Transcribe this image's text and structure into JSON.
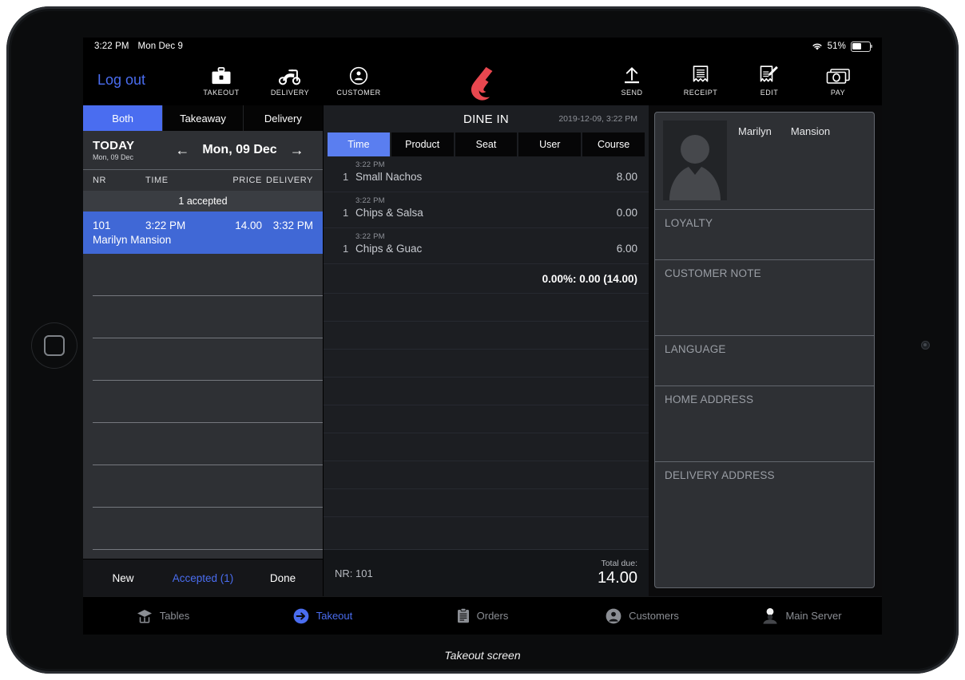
{
  "caption": "Takeout screen",
  "colors": {
    "accent_blue": "#4a6df0",
    "selected_row_blue": "#4068d6",
    "tab_active_blue": "#5a7ef0",
    "brand_red": "#e8474f",
    "panel_grey": "#2e3034",
    "mid_panel": "#1c1e22"
  },
  "status_bar": {
    "time": "3:22 PM",
    "date": "Mon Dec 9",
    "wifi_icon": "wifi-icon",
    "battery_percent": "51%",
    "battery_icon": "battery-icon"
  },
  "top_bar": {
    "logout_label": "Log out",
    "left_tools": [
      {
        "label": "TAKEOUT",
        "icon": "briefcase-icon"
      },
      {
        "label": "DELIVERY",
        "icon": "scooter-icon"
      },
      {
        "label": "CUSTOMER",
        "icon": "customer-circle-icon"
      }
    ],
    "brand_icon": "lightspeed-logo-icon",
    "right_tools": [
      {
        "label": "SEND",
        "icon": "send-up-arrow-icon"
      },
      {
        "label": "RECEIPT",
        "icon": "receipt-icon"
      },
      {
        "label": "EDIT",
        "icon": "edit-receipt-icon"
      },
      {
        "label": "PAY",
        "icon": "cash-icon"
      }
    ]
  },
  "left_panel": {
    "segments": [
      {
        "label": "Both",
        "active": true
      },
      {
        "label": "Takeaway",
        "active": false
      },
      {
        "label": "Delivery",
        "active": false
      }
    ],
    "today_label": "TODAY",
    "today_sub": "Mon, 09 Dec",
    "prev_arrow_icon": "arrow-left-icon",
    "next_arrow_icon": "arrow-right-icon",
    "current_date": "Mon, 09 Dec",
    "columns": [
      "NR",
      "TIME",
      "PRICE",
      "DELIVERY"
    ],
    "group_header": "1 accepted",
    "orders": [
      {
        "nr": "101",
        "time": "3:22 PM",
        "price": "14.00",
        "delivery": "3:32 PM",
        "customer": "Marilyn Mansion",
        "selected": true
      }
    ],
    "empty_row_count": 7,
    "footer_tabs": [
      {
        "label": "New",
        "active": false
      },
      {
        "label": "Accepted (1)",
        "active": true
      },
      {
        "label": "Done",
        "active": false
      }
    ]
  },
  "order_detail": {
    "title": "DINE IN",
    "timestamp": "2019-12-09, 3:22 PM",
    "tabs": [
      {
        "label": "Time",
        "active": true
      },
      {
        "label": "Product",
        "active": false
      },
      {
        "label": "Seat",
        "active": false
      },
      {
        "label": "User",
        "active": false
      },
      {
        "label": "Course",
        "active": false
      }
    ],
    "items": [
      {
        "time": "3:22 PM",
        "qty": "1",
        "name": "Small Nachos",
        "amount": "8.00"
      },
      {
        "time": "3:22 PM",
        "qty": "1",
        "name": "Chips & Salsa",
        "amount": "0.00"
      },
      {
        "time": "3:22 PM",
        "qty": "1",
        "name": "Chips & Guac",
        "amount": "6.00"
      }
    ],
    "discount_line": "0.00%: 0.00 (14.00)",
    "footer_nr": "NR: 101",
    "footer_total_label": "Total due:",
    "footer_total_value": "14.00"
  },
  "customer_panel": {
    "avatar_icon": "person-placeholder-icon",
    "first_name": "Marilyn",
    "last_name": "Mansion",
    "fields": [
      {
        "label": "LOYALTY",
        "value": ""
      },
      {
        "label": "CUSTOMER NOTE",
        "value": ""
      },
      {
        "label": "LANGUAGE",
        "value": ""
      },
      {
        "label": "HOME ADDRESS",
        "value": ""
      },
      {
        "label": "DELIVERY ADDRESS",
        "value": ""
      }
    ]
  },
  "tab_bar": [
    {
      "label": "Tables",
      "icon": "tables-icon",
      "active": false
    },
    {
      "label": "Takeout",
      "icon": "takeout-arrow-icon",
      "active": true
    },
    {
      "label": "Orders",
      "icon": "clipboard-icon",
      "active": false
    },
    {
      "label": "Customers",
      "icon": "person-circle-icon",
      "active": false
    },
    {
      "label": "Main Server",
      "icon": "server-icon",
      "active": false
    }
  ]
}
